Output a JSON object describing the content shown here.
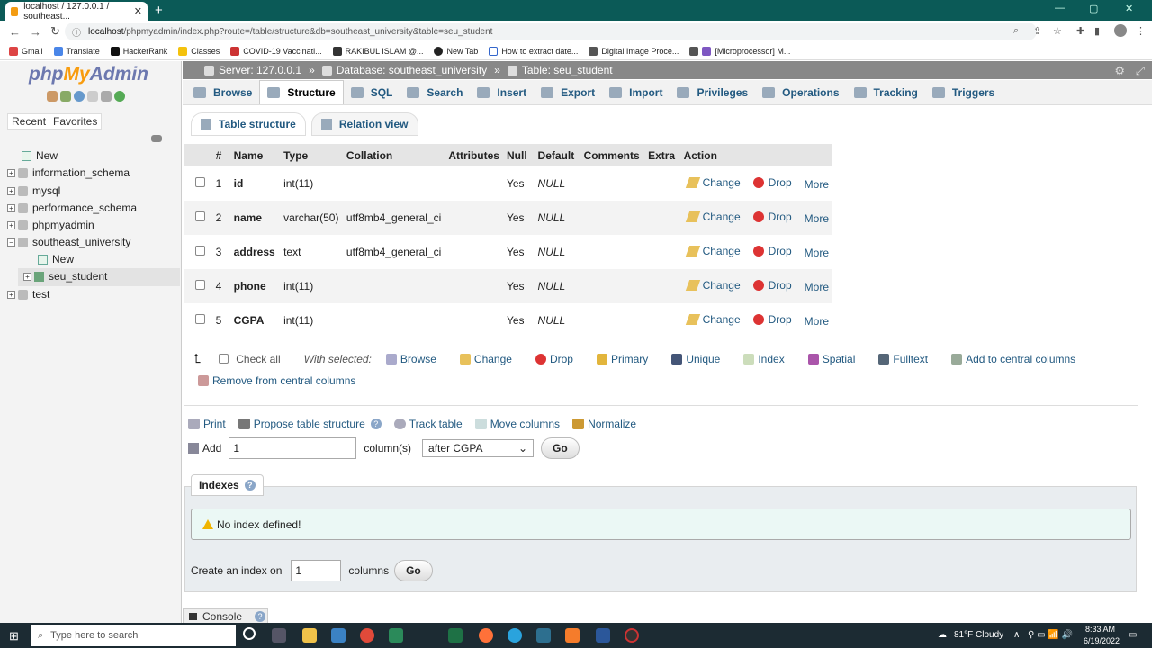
{
  "browser": {
    "tab_title": "localhost / 127.0.0.1 / southeast...",
    "url_host": "localhost",
    "url_path": "/phpmyadmin/index.php?route=/table/structure&db=southeast_university&table=seu_student",
    "bookmarks": [
      "Gmail",
      "Translate",
      "HackerRank",
      "Classes",
      "COVID-19 Vaccinati...",
      "RAKIBUL ISLAM @...",
      "New Tab",
      "How to extract date...",
      "Digital Image Proce...",
      "[Microprocessor] M..."
    ]
  },
  "sidebar": {
    "logo_php": "php",
    "logo_my": "My",
    "logo_admin": "Admin",
    "tabs": [
      "Recent",
      "Favorites"
    ],
    "tree": {
      "new": "New",
      "dbs": [
        "information_schema",
        "mysql",
        "performance_schema",
        "phpmyadmin",
        "southeast_university"
      ],
      "sub_new": "New",
      "table": "seu_student",
      "last_db": "test"
    }
  },
  "breadcrumb": {
    "server": "Server: 127.0.0.1",
    "database": "Database: southeast_university",
    "table": "Table: seu_student"
  },
  "menu": [
    "Browse",
    "Structure",
    "SQL",
    "Search",
    "Insert",
    "Export",
    "Import",
    "Privileges",
    "Operations",
    "Tracking",
    "Triggers"
  ],
  "subtabs": [
    "Table structure",
    "Relation view"
  ],
  "table": {
    "headers": [
      "#",
      "Name",
      "Type",
      "Collation",
      "Attributes",
      "Null",
      "Default",
      "Comments",
      "Extra",
      "Action"
    ],
    "rows": [
      {
        "num": "1",
        "name": "id",
        "type": "int(11)",
        "collation": "",
        "null": "Yes",
        "default": "NULL"
      },
      {
        "num": "2",
        "name": "name",
        "type": "varchar(50)",
        "collation": "utf8mb4_general_ci",
        "null": "Yes",
        "default": "NULL"
      },
      {
        "num": "3",
        "name": "address",
        "type": "text",
        "collation": "utf8mb4_general_ci",
        "null": "Yes",
        "default": "NULL"
      },
      {
        "num": "4",
        "name": "phone",
        "type": "int(11)",
        "collation": "",
        "null": "Yes",
        "default": "NULL"
      },
      {
        "num": "5",
        "name": "CGPA",
        "type": "int(11)",
        "collation": "",
        "null": "Yes",
        "default": "NULL"
      }
    ],
    "actions": {
      "change": "Change",
      "drop": "Drop",
      "more": "More"
    }
  },
  "with_selected": {
    "check_all": "Check all",
    "label": "With selected:",
    "items": [
      "Browse",
      "Change",
      "Drop",
      "Primary",
      "Unique",
      "Index",
      "Spatial",
      "Fulltext",
      "Add to central columns"
    ],
    "remove": "Remove from central columns"
  },
  "tools": {
    "print": "Print",
    "propose": "Propose table structure",
    "track": "Track table",
    "move": "Move columns",
    "normalize": "Normalize"
  },
  "add": {
    "label": "Add",
    "value": "1",
    "columns_label": "column(s)",
    "position": "after CGPA",
    "go": "Go"
  },
  "indexes": {
    "legend": "Indexes",
    "notice": "No index defined!",
    "create_label": "Create an index on",
    "create_value": "1",
    "columns_label": "columns",
    "go": "Go"
  },
  "console": "Console",
  "taskbar": {
    "search_placeholder": "Type here to search",
    "weather": "81°F  Cloudy",
    "time": "8:33 AM",
    "date": "6/19/2022"
  }
}
